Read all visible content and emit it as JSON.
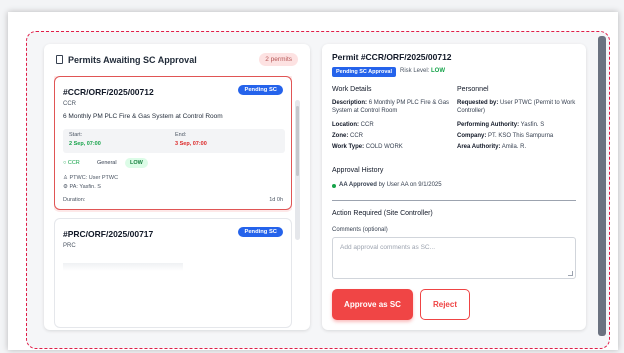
{
  "left_panel": {
    "title": "Permits Awaiting SC Approval",
    "count_label": "2 permits",
    "permits": [
      {
        "id": "#CCR/ORF/2025/00712",
        "status": "Pending SC",
        "location_code": "CCR",
        "description": "6 Monthly PM PLC Fire & Gas System at Control Room",
        "start_label": "Start:",
        "start_value": "2 Sep, 07:00",
        "end_label": "End:",
        "end_value": "3 Sep, 07:00",
        "tag_location": "CCR",
        "tag_type": "General",
        "tag_risk": "LOW",
        "requester": "PTWC: User PTWC",
        "performer": "PA: Yasfin. S",
        "duration_label": "Duration:",
        "duration_value": "1d 0h"
      },
      {
        "id": "#PRC/ORF/2025/00717",
        "status": "Pending SC",
        "location_code": "PRC"
      }
    ]
  },
  "detail": {
    "title": "Permit #CCR/ORF/2025/00712",
    "status_badge": "Pending SC Approval",
    "risk_label": "Risk Level:",
    "risk_value": "LOW",
    "work_details_heading": "Work Details",
    "description_label": "Description:",
    "description_value": "6 Monthly PM PLC Fire & Gas System at Control Room",
    "location_label": "Location:",
    "location_value": "CCR",
    "zone_label": "Zone:",
    "zone_value": "CCR",
    "work_type_label": "Work Type:",
    "work_type_value": "COLD WORK",
    "personnel_heading": "Personnel",
    "requested_by_label": "Requested by:",
    "requested_by_value": "User PTWC (Permit to Work Controller)",
    "performing_label": "Performing Authority:",
    "performing_value": "Yasfin. S",
    "company_label": "Company:",
    "company_value": "PT. KSO This Sampurna",
    "area_label": "Area Authority:",
    "area_value": "Amila. R.",
    "history_heading": "Approval History",
    "history_item_bold": "AA Approved",
    "history_item_rest": "by User AA on 9/1/2025",
    "action_heading": "Action Required (Site Controller)",
    "comments_label": "Comments (optional)",
    "comments_placeholder": "Add approval comments as SC...",
    "approve_label": "Approve as SC",
    "reject_label": "Reject"
  },
  "colors": {
    "accent_red": "#f04545",
    "badge_blue": "#2563eb",
    "risk_green": "#16a34a"
  }
}
